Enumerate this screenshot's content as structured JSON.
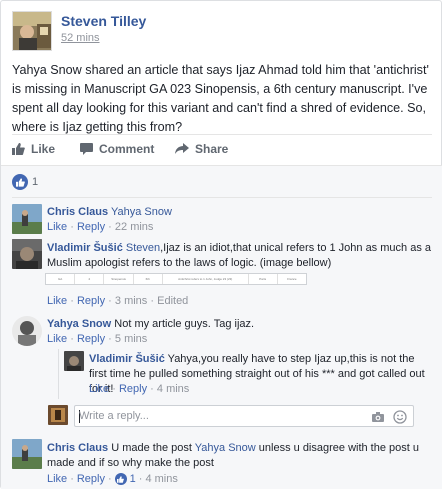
{
  "post": {
    "author": "Steven Tilley",
    "timestamp": "52 mins",
    "text": "Yahya Snow shared an article that says Ijaz Ahmad told him that 'antichrist' is missing in Manuscript GA 023 Sinopensis, a 6th century manuscript. I've spent all day looking for this variant and can't find a shred of evidence. So, where is Ijaz getting this from?",
    "actions": {
      "like": "Like",
      "comment": "Comment",
      "share": "Share"
    },
    "reaction_count": "1"
  },
  "comments": [
    {
      "author": "Chris Claus",
      "mention": "Yahya Snow",
      "text": "",
      "like": "Like",
      "reply": "Reply",
      "sep": "·",
      "time": "22 mins"
    },
    {
      "author": "Vladimir Šušić",
      "mention": "Steven",
      "text": ",Ijaz is an idiot,that unical refers to 1 John as much as a Muslim apologist refers to the laws of logic. (image bellow)",
      "attachment_cells": [
        "GA",
        "2",
        "Sinopensis",
        "6th",
        "Antichrist refers to 1 John, Judge 23 (23)",
        "Paris",
        "France"
      ],
      "like": "Like",
      "reply": "Reply",
      "sep": "·",
      "time": "3 mins",
      "edited": "Edited"
    },
    {
      "author": "Yahya Snow",
      "text": "Not my article guys. Tag ijaz.",
      "like": "Like",
      "reply": "Reply",
      "sep": "·",
      "time": "5 mins",
      "replies": [
        {
          "author": "Vladimir Šušić",
          "text": "Yahya,you really have to step Ijaz up,this is not the first time he pulled something straight out of his *** and got called out for it!",
          "like": "Like",
          "reply": "Reply",
          "sep": "·",
          "time": "4 mins"
        }
      ],
      "reply_box": {
        "placeholder": "Write a reply..."
      }
    },
    {
      "author": "Chris Claus",
      "text_before": "U made the post ",
      "mention": "Yahya Snow",
      "text_after": " unless u disagree with the post u made and if so why make the post",
      "like": "Like",
      "reply": "Reply",
      "sep": "·",
      "like_count": "1",
      "time": "4 mins"
    }
  ],
  "colors": {
    "link": "#365899",
    "brand": "#4267b2",
    "muted": "#90949c",
    "text": "#1d2129"
  },
  "icons": [
    "thumbs-up-icon",
    "comment-icon",
    "share-arrow-icon",
    "like-circle-icon",
    "camera-icon",
    "smiley-icon"
  ]
}
